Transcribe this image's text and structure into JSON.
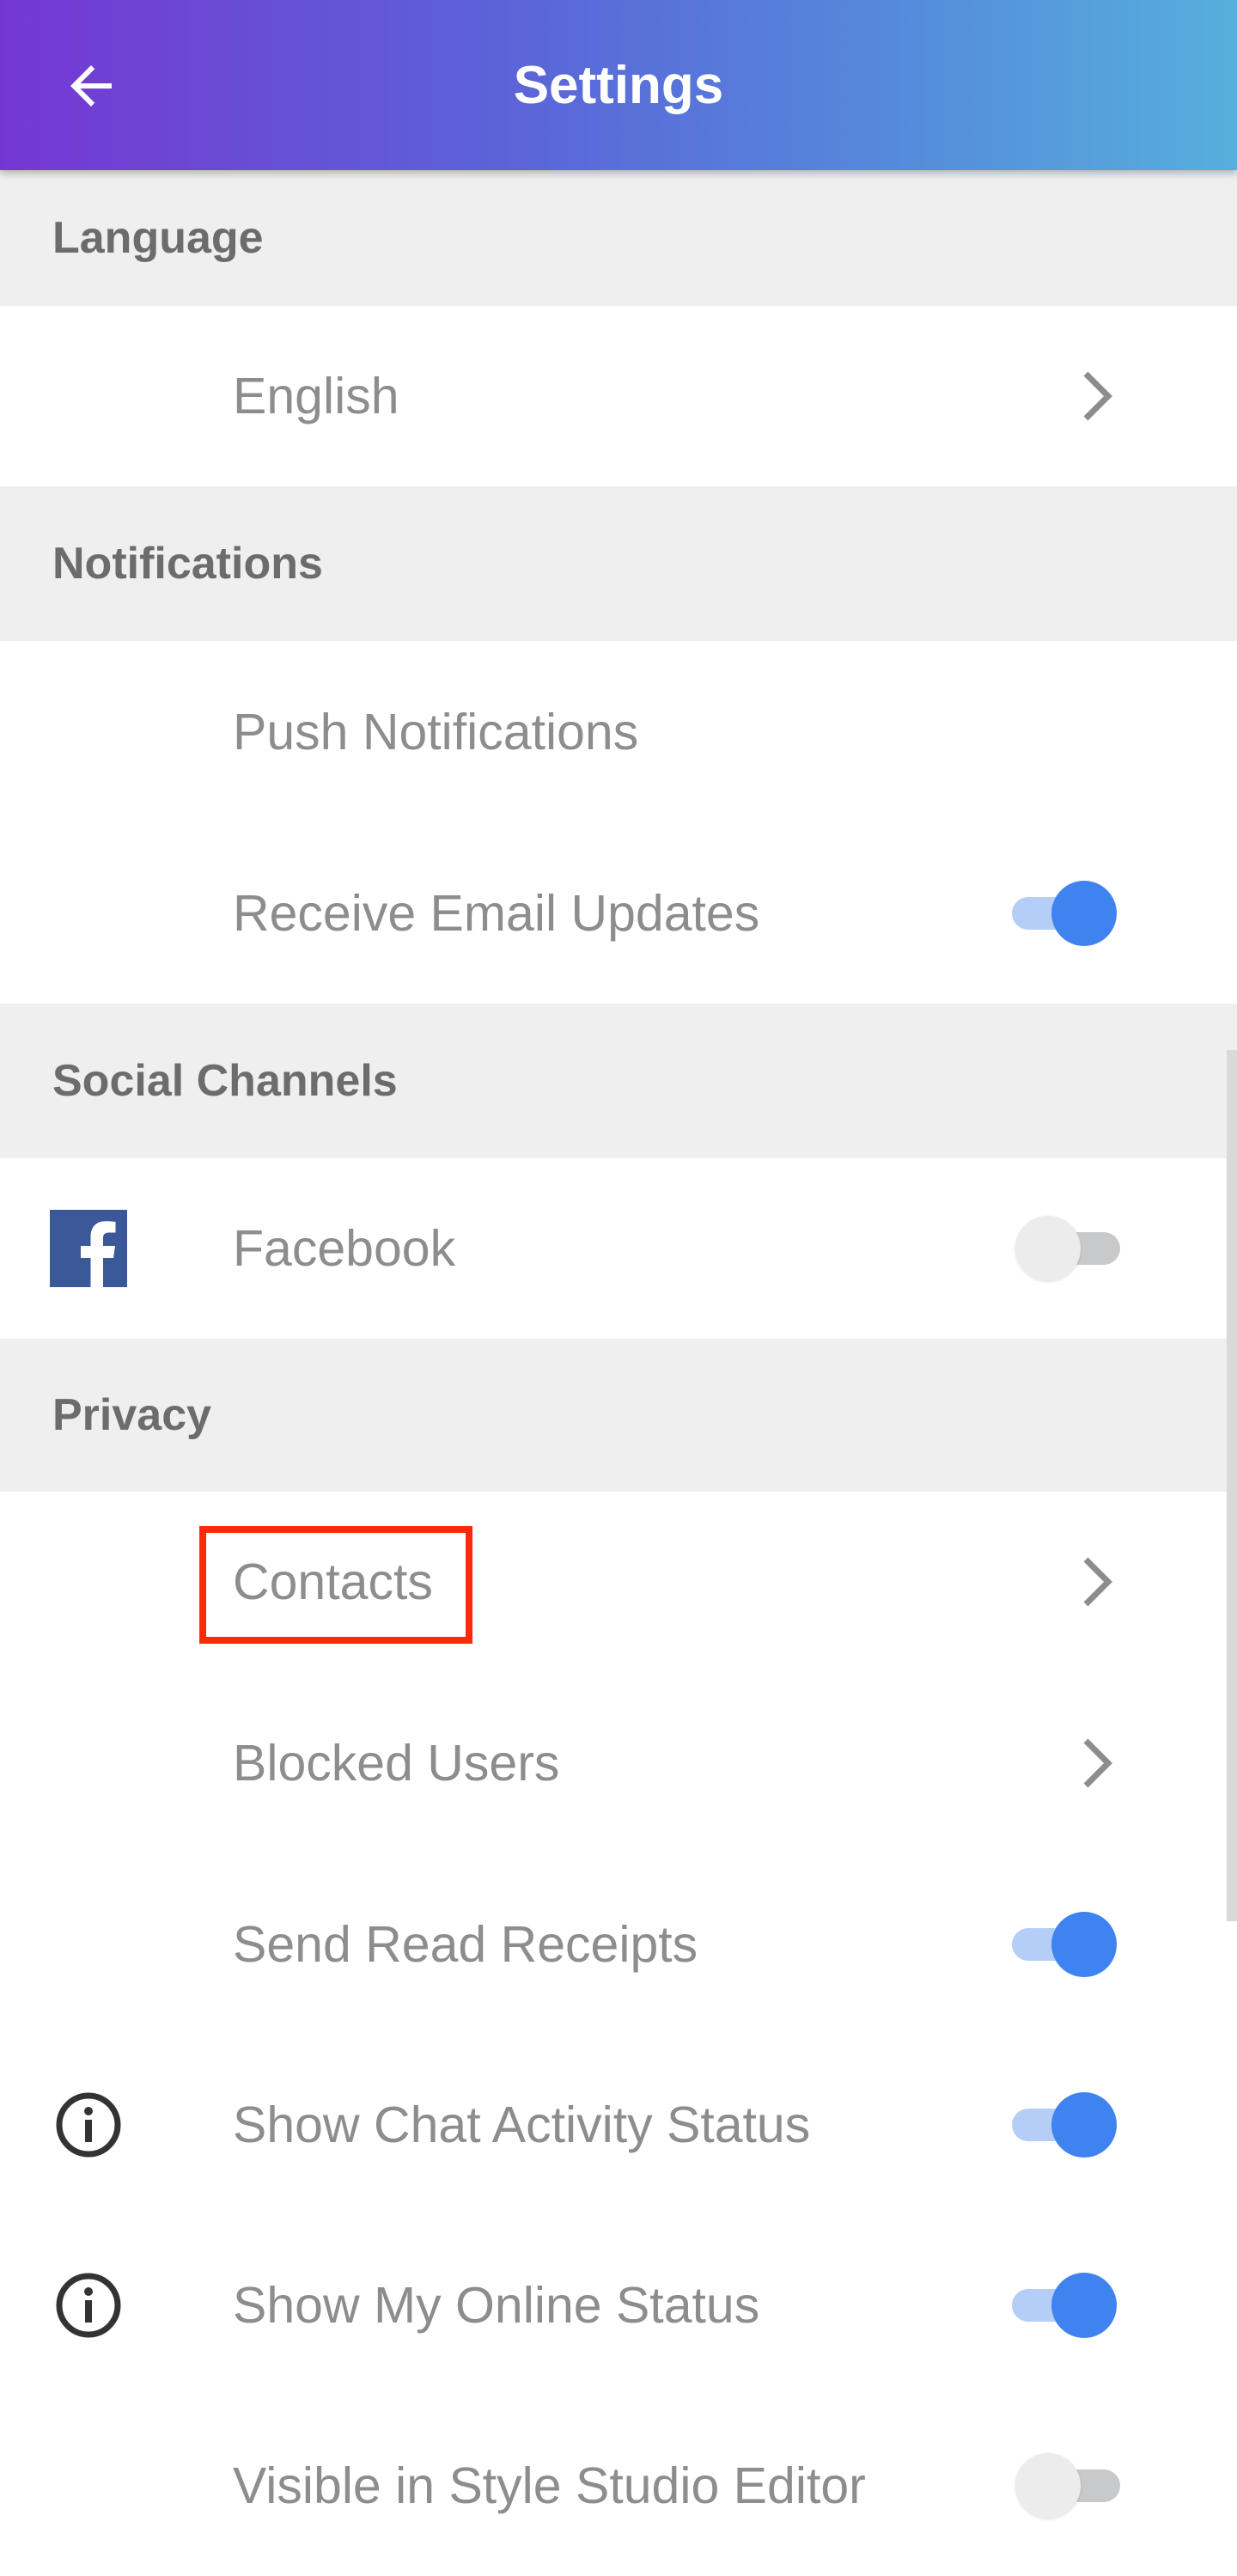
{
  "app_bar": {
    "title": "Settings",
    "back_icon": "arrow-left-icon",
    "gradient": [
      "#7537d3",
      "#56afdc"
    ]
  },
  "sections": {
    "language": {
      "header": "Language",
      "items": [
        {
          "label": "English",
          "control": "chevron"
        }
      ]
    },
    "notifications": {
      "header": "Notifications",
      "items": [
        {
          "label": "Push Notifications",
          "control": "none"
        },
        {
          "label": "Receive Email Updates",
          "control": "toggle",
          "state": "on"
        }
      ]
    },
    "social": {
      "header": "Social Channels",
      "items": [
        {
          "label": "Facebook",
          "icon": "facebook-icon",
          "control": "toggle",
          "state": "off"
        }
      ]
    },
    "privacy": {
      "header": "Privacy",
      "items": [
        {
          "label": "Contacts",
          "control": "chevron"
        },
        {
          "label": "Blocked Users",
          "control": "chevron"
        },
        {
          "label": "Send Read Receipts",
          "control": "toggle",
          "state": "on"
        },
        {
          "label": "Show Chat Activity Status",
          "icon": "info-icon",
          "control": "toggle",
          "state": "on"
        },
        {
          "label": "Show My Online Status",
          "icon": "info-icon",
          "control": "toggle",
          "state": "on"
        },
        {
          "label": "Visible in Style Studio Editor",
          "control": "toggle",
          "state": "off"
        }
      ]
    }
  },
  "colors": {
    "accent": "#3f83f0",
    "highlight": "#ff2a0e",
    "section_bg": "#efefef",
    "facebook": "#3b5998"
  }
}
